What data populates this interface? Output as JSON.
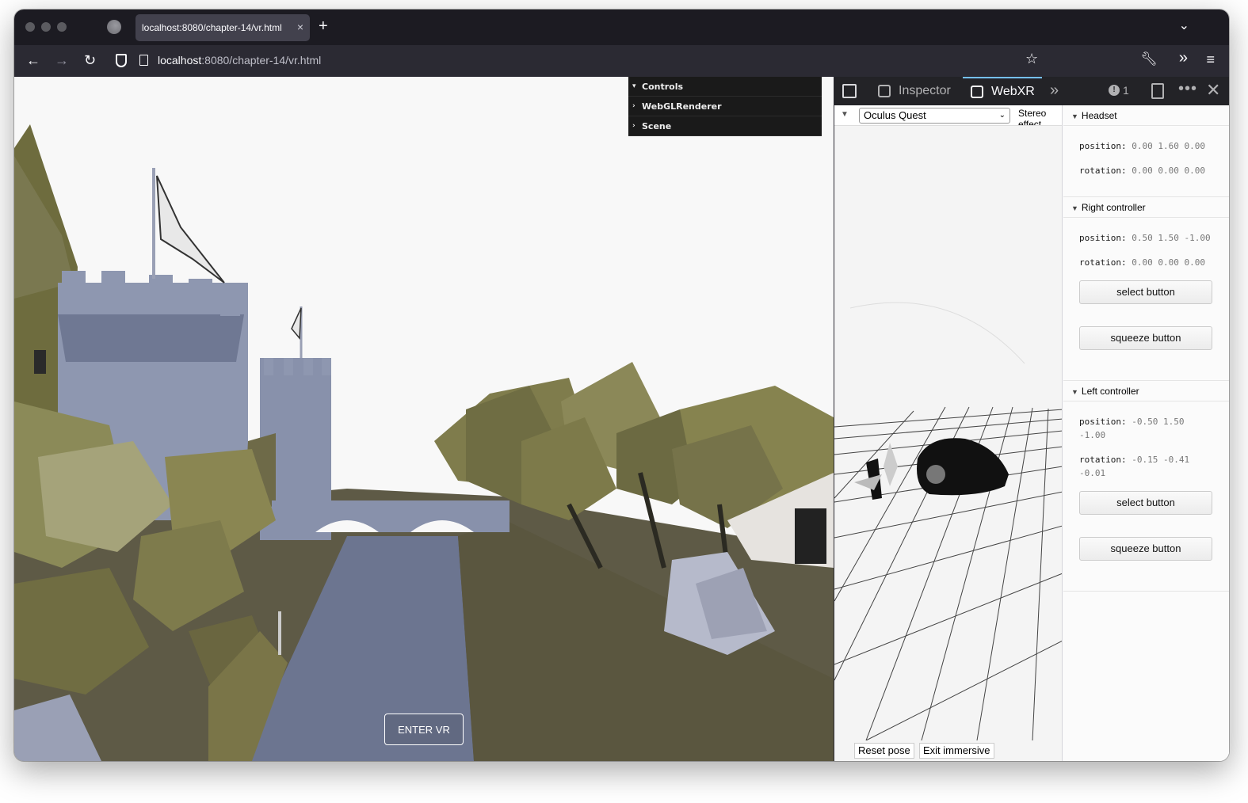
{
  "browser": {
    "tab_title": "localhost:8080/chapter-14/vr.html",
    "tab_close": "×",
    "new_tab": "+",
    "url_host": "localhost",
    "url_rest": ":8080/chapter-14/vr.html"
  },
  "gui": {
    "items": [
      {
        "caret": "▾",
        "label": "Controls"
      },
      {
        "caret": "›",
        "label": "WebGLRenderer"
      },
      {
        "caret": "›",
        "label": "Scene"
      }
    ]
  },
  "scene": {
    "enter_vr": "ENTER VR"
  },
  "devtools": {
    "tabs": {
      "inspector": "Inspector",
      "webxr": "WebXR"
    },
    "warning_count": "1",
    "webxr": {
      "device_select": "Oculus Quest",
      "stereo_label": "Stereo effect",
      "reset_pose": "Reset pose",
      "exit_immersive": "Exit immersive",
      "sections": [
        {
          "title": "Headset",
          "position_label": "position:",
          "position_value": "0.00 1.60 0.00",
          "rotation_label": "rotation:",
          "rotation_value": "0.00 0.00 0.00"
        },
        {
          "title": "Right controller",
          "position_label": "position:",
          "position_value": "0.50 1.50 -1.00",
          "rotation_label": "rotation:",
          "rotation_value": "0.00 0.00 0.00",
          "select_button": "select button",
          "squeeze_button": "squeeze button"
        },
        {
          "title": "Left controller",
          "position_label": "position:",
          "position_value": "-0.50 1.50 -1.00",
          "rotation_label": "rotation:",
          "rotation_value": "-0.15 -0.41 -0.01",
          "select_button": "select button",
          "squeeze_button": "squeeze button"
        }
      ]
    }
  }
}
